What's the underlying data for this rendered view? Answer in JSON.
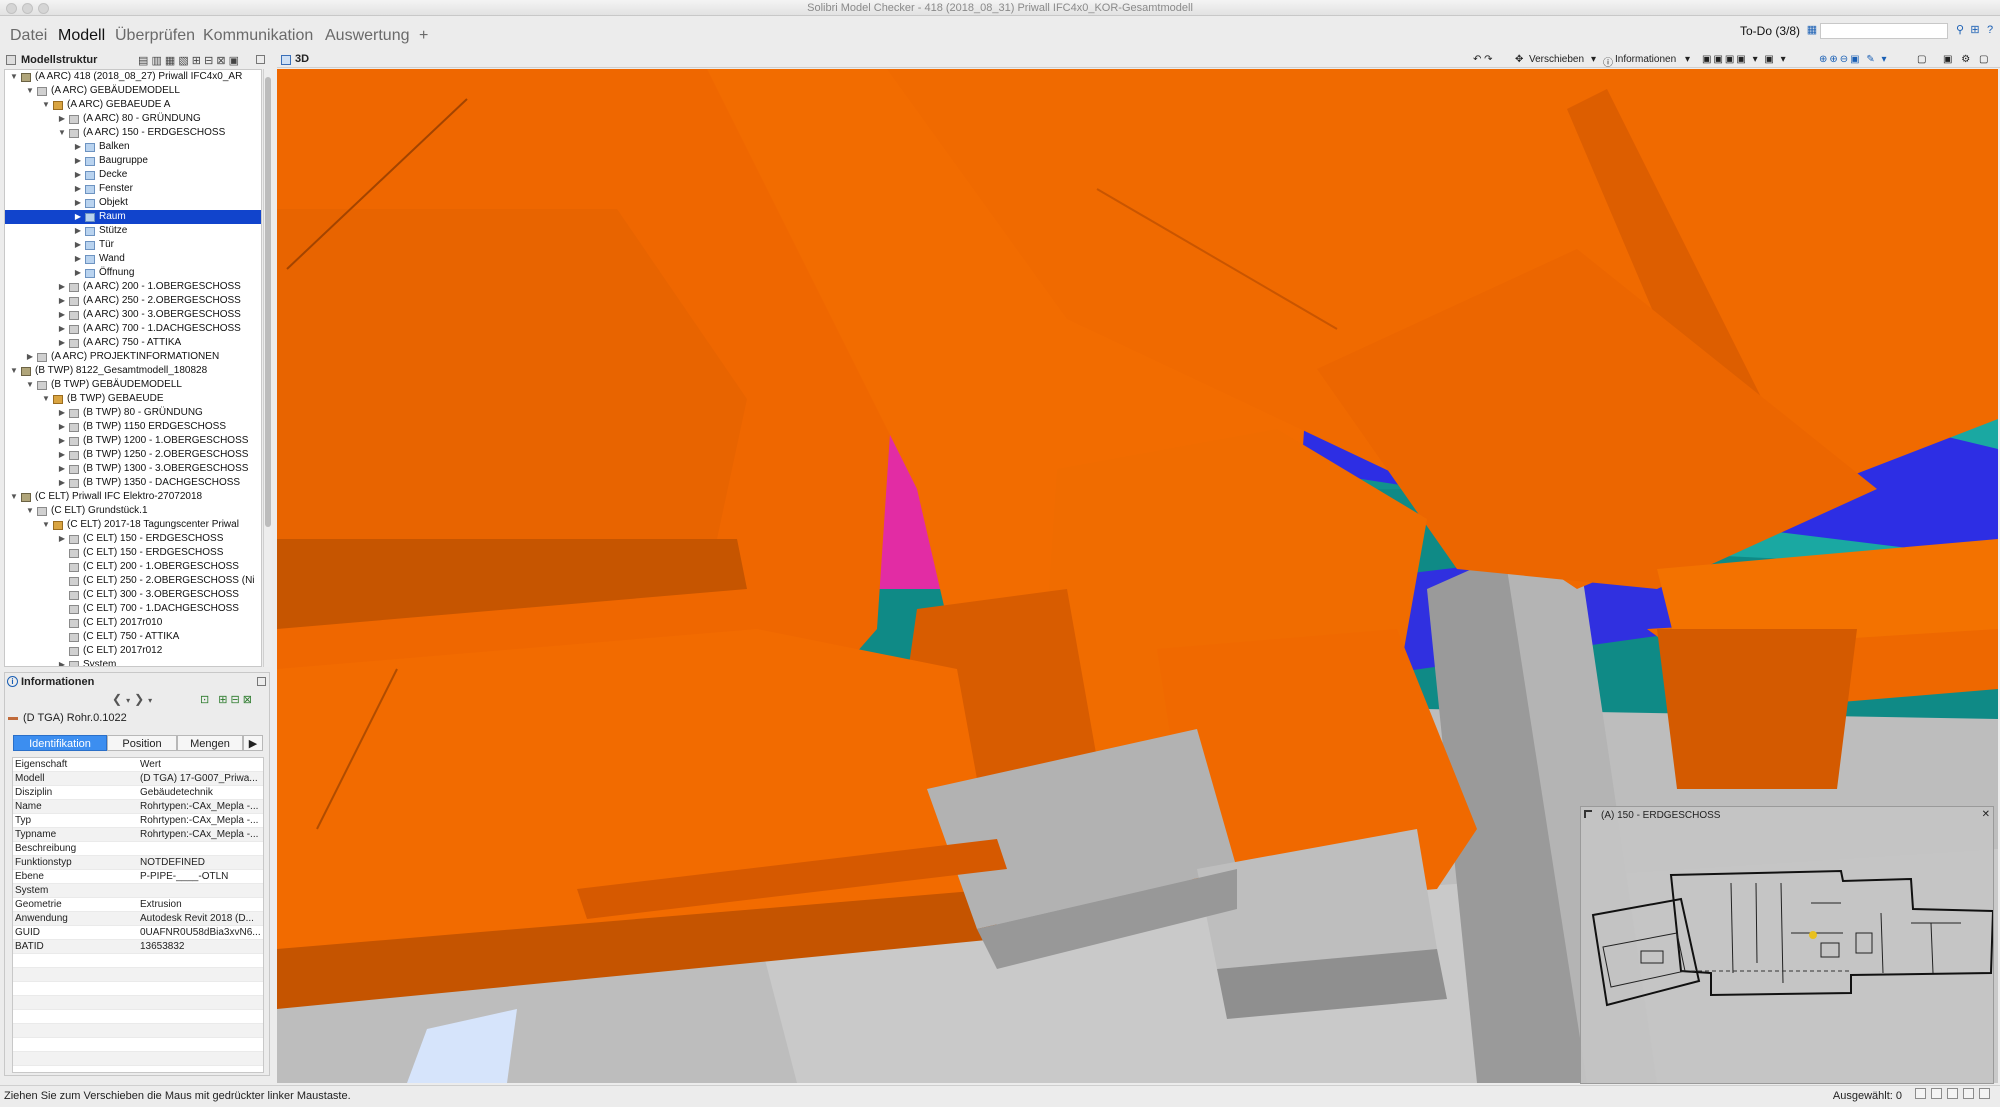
{
  "window": {
    "title": "Solibri Model Checker - 418 (2018_08_31) Priwall IFC4x0_KOR-Gesamtmodell"
  },
  "menu": {
    "items": [
      "Datei",
      "Modell",
      "Überprüfen",
      "Kommunikation",
      "Auswertung",
      "+"
    ],
    "active": "Modell"
  },
  "todo": {
    "label": "To-Do (3/8)"
  },
  "left_panel": {
    "title": "Modellstruktur"
  },
  "tree": [
    {
      "label": "(A ARC) 418 (2018_08_27) Priwall IFC4x0_AR",
      "level": 0,
      "toggle": "▼",
      "icon": "model"
    },
    {
      "label": "(A ARC) GEBÄUDEMODELL",
      "level": 1,
      "toggle": "▼",
      "icon": "plain"
    },
    {
      "label": "(A ARC) GEBAEUDE A",
      "level": 2,
      "toggle": "▼",
      "icon": "bld"
    },
    {
      "label": "(A ARC) 80 - GRÜNDUNG",
      "level": 3,
      "toggle": "▶",
      "icon": "plain"
    },
    {
      "label": "(A ARC) 150 - ERDGESCHOSS",
      "level": 3,
      "toggle": "▼",
      "icon": "plain"
    },
    {
      "label": "Balken",
      "level": 4,
      "toggle": "▶",
      "icon": "folder"
    },
    {
      "label": "Baugruppe",
      "level": 4,
      "toggle": "▶",
      "icon": "folder"
    },
    {
      "label": "Decke",
      "level": 4,
      "toggle": "▶",
      "icon": "folder"
    },
    {
      "label": "Fenster",
      "level": 4,
      "toggle": "▶",
      "icon": "folder"
    },
    {
      "label": "Objekt",
      "level": 4,
      "toggle": "▶",
      "icon": "folder"
    },
    {
      "label": "Raum",
      "level": 4,
      "toggle": "▶",
      "icon": "folder",
      "selected": true
    },
    {
      "label": "Stütze",
      "level": 4,
      "toggle": "▶",
      "icon": "folder"
    },
    {
      "label": "Tür",
      "level": 4,
      "toggle": "▶",
      "icon": "folder"
    },
    {
      "label": "Wand",
      "level": 4,
      "toggle": "▶",
      "icon": "folder"
    },
    {
      "label": "Öffnung",
      "level": 4,
      "toggle": "▶",
      "icon": "folder"
    },
    {
      "label": "(A ARC) 200 - 1.OBERGESCHOSS",
      "level": 3,
      "toggle": "▶",
      "icon": "plain"
    },
    {
      "label": "(A ARC) 250 - 2.OBERGESCHOSS",
      "level": 3,
      "toggle": "▶",
      "icon": "plain"
    },
    {
      "label": "(A ARC) 300 - 3.OBERGESCHOSS",
      "level": 3,
      "toggle": "▶",
      "icon": "plain"
    },
    {
      "label": "(A ARC) 700 - 1.DACHGESCHOSS",
      "level": 3,
      "toggle": "▶",
      "icon": "plain"
    },
    {
      "label": "(A ARC) 750 - ATTIKA",
      "level": 3,
      "toggle": "▶",
      "icon": "plain"
    },
    {
      "label": "(A ARC) PROJEKTINFORMATIONEN",
      "level": 1,
      "toggle": "▶",
      "icon": "plain"
    },
    {
      "label": "(B TWP) 8122_Gesamtmodell_180828",
      "level": 0,
      "toggle": "▼",
      "icon": "model"
    },
    {
      "label": "(B TWP) GEBÄUDEMODELL",
      "level": 1,
      "toggle": "▼",
      "icon": "plain"
    },
    {
      "label": "(B TWP) GEBAEUDE",
      "level": 2,
      "toggle": "▼",
      "icon": "bld"
    },
    {
      "label": "(B TWP) 80 - GRÜNDUNG",
      "level": 3,
      "toggle": "▶",
      "icon": "plain"
    },
    {
      "label": "(B TWP) 1150 ERDGESCHOSS",
      "level": 3,
      "toggle": "▶",
      "icon": "plain"
    },
    {
      "label": "(B TWP) 1200 - 1.OBERGESCHOSS",
      "level": 3,
      "toggle": "▶",
      "icon": "plain"
    },
    {
      "label": "(B TWP) 1250 - 2.OBERGESCHOSS",
      "level": 3,
      "toggle": "▶",
      "icon": "plain"
    },
    {
      "label": "(B TWP) 1300 - 3.OBERGESCHOSS",
      "level": 3,
      "toggle": "▶",
      "icon": "plain"
    },
    {
      "label": "(B TWP) 1350 - DACHGESCHOSS",
      "level": 3,
      "toggle": "▶",
      "icon": "plain"
    },
    {
      "label": "(C ELT) Priwall IFC Elektro-27072018",
      "level": 0,
      "toggle": "▼",
      "icon": "model"
    },
    {
      "label": "(C ELT) Grundstück.1",
      "level": 1,
      "toggle": "▼",
      "icon": "plain"
    },
    {
      "label": "(C ELT) 2017-18 Tagungscenter Priwal",
      "level": 2,
      "toggle": "▼",
      "icon": "bld"
    },
    {
      "label": "(C ELT) 150 - ERDGESCHOSS",
      "level": 3,
      "toggle": "▶",
      "icon": "plain"
    },
    {
      "label": "(C ELT) 150 - ERDGESCHOSS",
      "level": 3,
      "toggle": "",
      "icon": "plain"
    },
    {
      "label": "(C ELT) 200 - 1.OBERGESCHOSS",
      "level": 3,
      "toggle": "",
      "icon": "plain"
    },
    {
      "label": "(C ELT) 250 - 2.OBERGESCHOSS (Ni",
      "level": 3,
      "toggle": "",
      "icon": "plain"
    },
    {
      "label": "(C ELT) 300 - 3.OBERGESCHOSS",
      "level": 3,
      "toggle": "",
      "icon": "plain"
    },
    {
      "label": "(C ELT) 700 - 1.DACHGESCHOSS",
      "level": 3,
      "toggle": "",
      "icon": "plain"
    },
    {
      "label": "(C ELT) 2017r010",
      "level": 3,
      "toggle": "",
      "icon": "plain"
    },
    {
      "label": "(C ELT) 750 - ATTIKA",
      "level": 3,
      "toggle": "",
      "icon": "plain"
    },
    {
      "label": "(C ELT) 2017r012",
      "level": 3,
      "toggle": "",
      "icon": "plain"
    },
    {
      "label": "System",
      "level": 3,
      "toggle": "▶",
      "icon": "plain"
    }
  ],
  "info_panel": {
    "title": "Informationen",
    "selected_item": "(D TGA) Rohr.0.1022",
    "tabs": [
      "Identifikation",
      "Position",
      "Mengen"
    ],
    "columns": [
      "Eigenschaft",
      "Wert"
    ],
    "rows": [
      [
        "Modell",
        "(D TGA) 17-G007_Priwa..."
      ],
      [
        "Disziplin",
        "Gebäudetechnik"
      ],
      [
        "Name",
        "Rohrtypen:-CAx_Mepla -..."
      ],
      [
        "Typ",
        "Rohrtypen:-CAx_Mepla -..."
      ],
      [
        "Typname",
        "Rohrtypen:-CAx_Mepla -..."
      ],
      [
        "Beschreibung",
        ""
      ],
      [
        "Funktionstyp",
        "NOTDEFINED"
      ],
      [
        "Ebene",
        "P-PIPE-____-OTLN"
      ],
      [
        "System",
        ""
      ],
      [
        "Geometrie",
        "Extrusion"
      ],
      [
        "Anwendung",
        "Autodesk Revit 2018 (D..."
      ],
      [
        "GUID",
        "0UAFNR0U58dBia3xvN6..."
      ],
      [
        "BATID",
        "13653832"
      ]
    ]
  },
  "view": {
    "title": "3D",
    "toolbar": {
      "move": "Verschieben",
      "info": "Informationen"
    },
    "minimap_title": "(A) 150 - ERDGESCHOSS"
  },
  "colors": {
    "duct_orange": "#f06a00",
    "duct_blue": "#2f2fe6",
    "teal": "#0f8f8a",
    "magenta": "#e02ca0",
    "grey": "#a4a4a4",
    "selection": "#1144cc"
  },
  "status": {
    "left": "Ziehen Sie zum Verschieben die Maus mit gedrückter linker Maustaste.",
    "right": "Ausgewählt: 0"
  }
}
